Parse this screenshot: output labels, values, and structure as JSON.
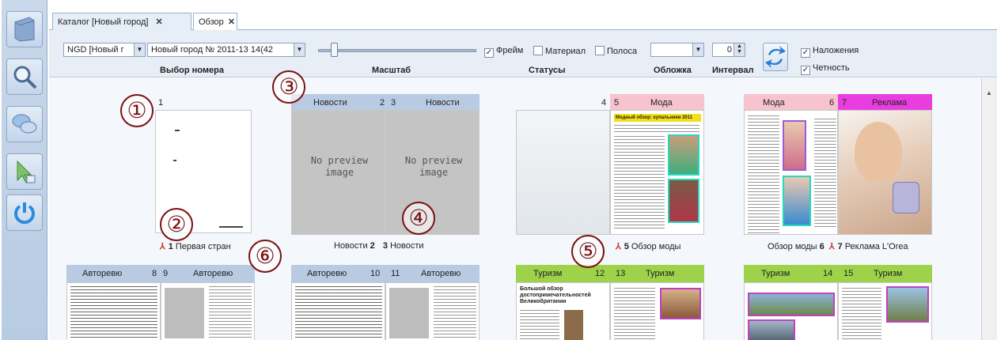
{
  "tabs": [
    {
      "label": "Каталог [Новый город]"
    },
    {
      "label": "Обзор"
    }
  ],
  "toolbar": {
    "publication_select": "NGD [Новый г",
    "issue_select": "Новый город № 2011-13 14(42",
    "label_issue": "Выбор номера",
    "label_scale": "Масштаб",
    "label_statuses": "Статусы",
    "chk_frame": "Фрейм",
    "chk_material": "Материал",
    "chk_strip": "Полоса",
    "label_cover": "Обложка",
    "label_interval": "Интервал",
    "interval_value": "0",
    "chk_overlays": "Наложения",
    "chk_parity": "Четность"
  },
  "annotations": [
    "①",
    "②",
    "③",
    "④",
    "⑤",
    "⑥"
  ],
  "spreads": [
    {
      "left_num": "",
      "right_num": "1",
      "left_section": "",
      "right_section": "",
      "caption_left": "",
      "caption_right": "Первая стран",
      "cap_right_num": "1"
    },
    {
      "left_section": "Новости",
      "left_num": "2",
      "right_num": "3",
      "right_section": "Новости",
      "preview": "No preview\nimage",
      "caption_left": "Новости",
      "cap_left_num": "2",
      "cap_right_num": "3",
      "caption_right": "Новости"
    },
    {
      "left_num": "4",
      "right_num": "5",
      "right_section": "Мода",
      "caption_right": "Обзор моды",
      "cap_right_num": "5",
      "headline": "Модный обзор: купальники 2011"
    },
    {
      "left_section": "Мода",
      "left_num": "6",
      "right_num": "7",
      "right_section": "Реклама",
      "caption_left": "Обзор моды",
      "cap_left_num": "6",
      "cap_right_num": "7",
      "caption_right": "Реклама L'Orea"
    }
  ],
  "row2": [
    {
      "left_section": "Авторевю",
      "left_num": "8",
      "right_num": "9",
      "right_section": "Авторевю"
    },
    {
      "left_section": "Авторевю",
      "left_num": "10",
      "right_num": "11",
      "right_section": "Авторевю"
    },
    {
      "left_section": "Туризм",
      "left_num": "12",
      "right_num": "13",
      "right_section": "Туризм",
      "headline": "Большой обзор достопримечательностей Великобритании"
    },
    {
      "left_section": "Туризм",
      "left_num": "14",
      "right_num": "15",
      "right_section": "Туризм"
    }
  ],
  "colors": {
    "news": "#b9cbe3",
    "fashion": "#f6c3cf",
    "ads": "#e83ee0",
    "auto": "#b9cbe3",
    "tourism": "#9ed24a"
  }
}
